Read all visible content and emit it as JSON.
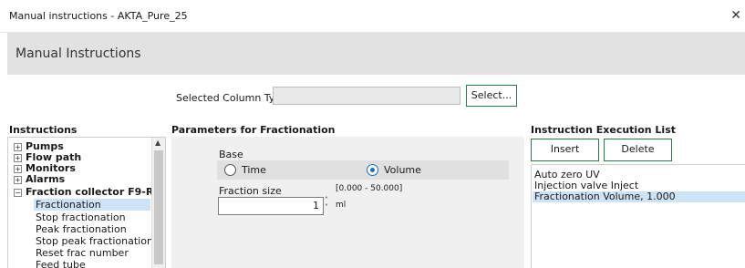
{
  "window": {
    "title": "Manual instructions - AKTA_Pure_25",
    "close_glyph": "✕"
  },
  "header": {
    "title": "Manual Instructions"
  },
  "column_type": {
    "label": "Selected Column Type",
    "value": "",
    "select_button": "Select..."
  },
  "instructions": {
    "title": "Instructions",
    "groups": [
      {
        "label": "Pumps",
        "expander": "+"
      },
      {
        "label": "Flow path",
        "expander": "+"
      },
      {
        "label": "Monitors",
        "expander": "+"
      },
      {
        "label": "Alarms",
        "expander": "+"
      },
      {
        "label": "Fraction collector F9-R",
        "expander": "−"
      }
    ],
    "sub_items": [
      "Fractionation",
      "Stop fractionation",
      "Peak fractionation",
      "Stop peak fractionation",
      "Reset frac number",
      "Feed tube"
    ],
    "selected_sub_item": "Fractionation"
  },
  "parameters": {
    "title": "Parameters for Fractionation",
    "base_label": "Base",
    "options": [
      {
        "label": "Time",
        "selected": false
      },
      {
        "label": "Volume",
        "selected": true
      }
    ],
    "fraction_size_label": "Fraction size",
    "fraction_size_range": "[0.000 - 50.000]",
    "fraction_size_value": "1",
    "fraction_size_unit": "ml"
  },
  "execution": {
    "title": "Instruction Execution List",
    "insert_button": "Insert",
    "delete_button": "Delete",
    "items": [
      "Auto zero UV",
      "Injection valve Inject",
      "Fractionation Volume, 1.000"
    ],
    "selected_item": "Fractionation Volume, 1.000"
  },
  "colors": {
    "accent_button_border": "#2a7a4a",
    "selection_highlight": "#cfe3f7",
    "header_bg": "#e2e2e2",
    "radio_selected": "#1a6fc9"
  }
}
